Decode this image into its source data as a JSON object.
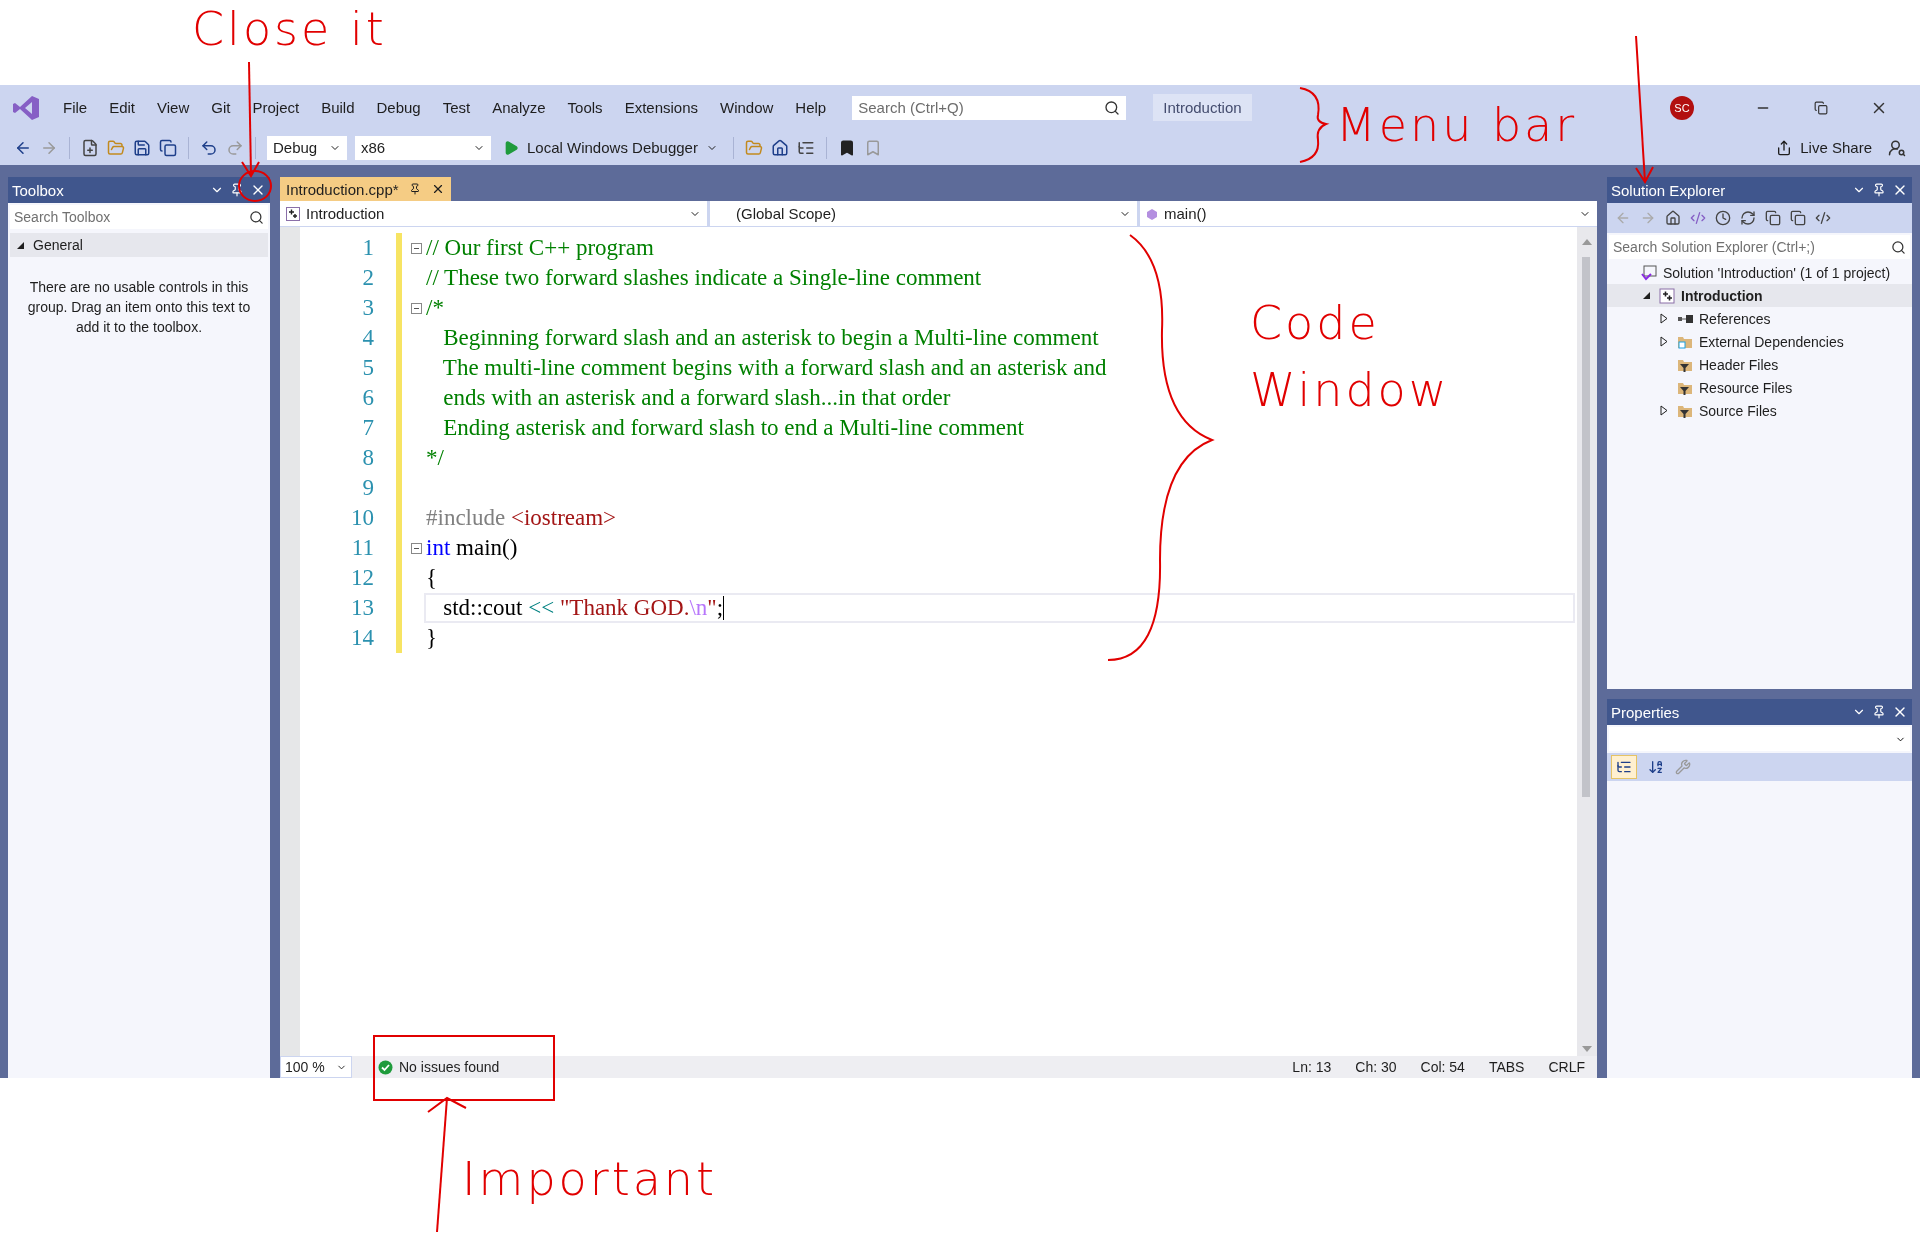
{
  "menu_bar": {
    "items": [
      {
        "label": "File"
      },
      {
        "label": "Edit"
      },
      {
        "label": "View"
      },
      {
        "label": "Git"
      },
      {
        "label": "Project"
      },
      {
        "label": "Build"
      },
      {
        "label": "Debug"
      },
      {
        "label": "Test"
      },
      {
        "label": "Analyze"
      },
      {
        "label": "Tools"
      },
      {
        "label": "Extensions"
      },
      {
        "label": "Window"
      },
      {
        "label": "Help"
      }
    ],
    "search": {
      "placeholder": "Search (Ctrl+Q)"
    },
    "solution_name": "Introduction",
    "account": {
      "initials": "SC"
    }
  },
  "toolbar": {
    "configuration": "Debug",
    "platform": "x86",
    "debugger": "Local Windows Debugger",
    "live_share": "Live Share"
  },
  "toolbox": {
    "title": "Toolbox",
    "search": {
      "placeholder": "Search Toolbox"
    },
    "group": {
      "label": "General",
      "expanded": true
    },
    "message": "There are no usable controls in this group. Drag an item onto this text to add it to the toolbox."
  },
  "editor": {
    "tabs": [
      {
        "label": "Introduction.cpp*",
        "selected": true
      }
    ],
    "navigation": [
      "Introduction",
      "(Global Scope)",
      "main()"
    ],
    "lines": [
      {
        "number": "1",
        "fold": true,
        "current": false,
        "tokens": [
          {
            "kind": "comment",
            "text": "// Our first C++ program"
          }
        ]
      },
      {
        "number": "2",
        "fold": false,
        "current": false,
        "tokens": [
          {
            "kind": "comment",
            "text": "// These two forward slashes indicate a Single-line comment"
          }
        ]
      },
      {
        "number": "3",
        "fold": true,
        "current": false,
        "tokens": [
          {
            "kind": "comment",
            "text": "/*"
          }
        ]
      },
      {
        "number": "4",
        "fold": false,
        "current": false,
        "tokens": [
          {
            "kind": "comment",
            "text": "   Beginning forward slash and an asterisk to begin a Multi-line comment"
          }
        ]
      },
      {
        "number": "5",
        "fold": false,
        "current": false,
        "tokens": [
          {
            "kind": "comment",
            "text": "   The multi-line comment begins with a forward slash and an asterisk and"
          }
        ]
      },
      {
        "number": "6",
        "fold": false,
        "current": false,
        "tokens": [
          {
            "kind": "comment",
            "text": "   ends with an asterisk and a forward slash...in that order"
          }
        ]
      },
      {
        "number": "7",
        "fold": false,
        "current": false,
        "tokens": [
          {
            "kind": "comment",
            "text": "   Ending asterisk and forward slash to end a Multi-line comment"
          }
        ]
      },
      {
        "number": "8",
        "fold": false,
        "current": false,
        "tokens": [
          {
            "kind": "comment",
            "text": "*/"
          }
        ]
      },
      {
        "number": "9",
        "fold": false,
        "current": false
      },
      {
        "number": "10",
        "fold": false,
        "current": false,
        "tokens": [
          {
            "kind": "preprocessor",
            "text": "#include "
          },
          {
            "kind": "string",
            "text": "<iostream>"
          }
        ]
      },
      {
        "number": "11",
        "fold": true,
        "current": false,
        "tokens": [
          {
            "kind": "keyword",
            "text": "int"
          },
          {
            "kind": "plain",
            "text": " main()"
          }
        ]
      },
      {
        "number": "12",
        "fold": false,
        "current": false,
        "tokens": [
          {
            "kind": "plain",
            "text": "{"
          }
        ]
      },
      {
        "number": "13",
        "fold": false,
        "current": true,
        "tokens": [
          {
            "kind": "plain",
            "text": "   std::cout "
          },
          {
            "kind": "operator",
            "text": "<<"
          },
          {
            "kind": "string",
            "text": " \"Thank GOD."
          },
          {
            "kind": "escape",
            "text": "\\n"
          },
          {
            "kind": "string",
            "text": "\""
          },
          {
            "kind": "plain",
            "text": ";"
          }
        ]
      },
      {
        "number": "14",
        "fold": false,
        "current": false,
        "tokens": [
          {
            "kind": "plain",
            "text": "}"
          }
        ]
      }
    ],
    "status": {
      "zoom": "100 %",
      "issues": "No issues found",
      "position": [
        "Ln: 13",
        "Ch: 30",
        "Col: 54",
        "TABS",
        "CRLF"
      ]
    }
  },
  "solution_explorer": {
    "title": "Solution Explorer",
    "search": {
      "placeholder": "Search Solution Explorer (Ctrl+;)"
    },
    "tree": [
      {
        "label": "Solution 'Introduction' (1 of 1 project)",
        "kind": "solution",
        "expandable": false,
        "selected": false,
        "children": [
          {
            "label": "Introduction",
            "kind": "project",
            "expandable": true,
            "expanded": true,
            "selected": true,
            "children": [
              {
                "label": "References",
                "kind": "references",
                "expandable": true,
                "expanded": false,
                "selected": false
              },
              {
                "label": "External Dependencies",
                "kind": "dependencies",
                "expandable": true,
                "expanded": false,
                "selected": false
              },
              {
                "label": "Header Files",
                "kind": "filter",
                "expandable": false,
                "selected": false
              },
              {
                "label": "Resource Files",
                "kind": "filter",
                "expandable": false,
                "selected": false
              },
              {
                "label": "Source Files",
                "kind": "filter",
                "expandable": true,
                "expanded": false,
                "selected": false
              }
            ]
          }
        ]
      }
    ]
  },
  "properties": {
    "title": "Properties",
    "views": [
      {
        "kind": "categorized",
        "selected": true
      },
      {
        "kind": "alphabetical",
        "selected": false
      }
    ]
  },
  "annotations": [
    {
      "kind": "close",
      "text": "Close it"
    },
    {
      "kind": "menu",
      "text": "Menu bar"
    },
    {
      "kind": "code",
      "text": "Code Window"
    },
    {
      "kind": "important",
      "text": "Important"
    }
  ]
}
